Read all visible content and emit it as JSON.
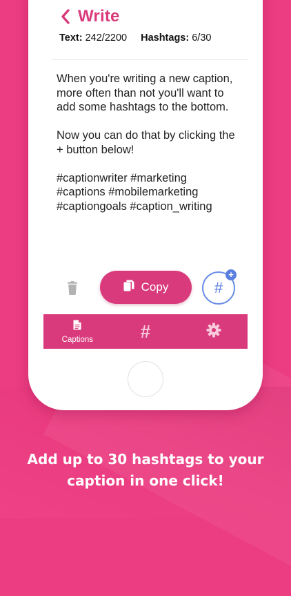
{
  "nav": {
    "title": "Write"
  },
  "stats": {
    "text_label": "Text:",
    "text_value": "242/2200",
    "hashtags_label": "Hashtags:",
    "hashtags_value": "6/30"
  },
  "caption": {
    "paragraph_1": "When you're writing a new caption, more often than not you'll want to add some hashtags to the bottom.",
    "paragraph_2": "Now you can do that by clicking the + button below!",
    "hashtag_line_1": "#captionwriter #marketing",
    "hashtag_line_2": "#captions #mobilemarketing",
    "hashtag_line_3": "#captiongoals #caption_writing"
  },
  "actions": {
    "copy_label": "Copy",
    "hashtag_button_glyph": "#",
    "plus_glyph": "+"
  },
  "tabbar": {
    "captions_label": "Captions",
    "hashtags_glyph": "#"
  },
  "promo": {
    "line_1": "Add up to 30 hashtags to your",
    "line_2": "caption in one click!"
  },
  "colors": {
    "background": "#ec3c82",
    "accent": "#d93a7c",
    "hashtag_blue": "#5b7fe0",
    "icon_gray": "#b3b3b3"
  },
  "icons": {
    "back": "chevron-left-icon",
    "trash": "trash-icon",
    "copy": "copy-icon",
    "captions_tab": "document-icon",
    "settings_tab": "gear-icon"
  }
}
